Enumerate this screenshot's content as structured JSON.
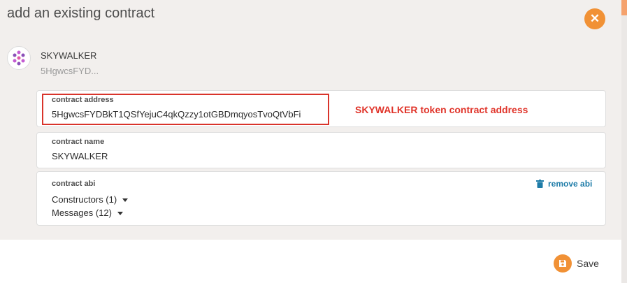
{
  "modal": {
    "title": "add an existing contract",
    "close_icon": "close-icon"
  },
  "account": {
    "name": "SKYWALKER",
    "address_short": "5HgwcsFYD..."
  },
  "fields": {
    "address": {
      "label": "contract address",
      "value": "5HgwcsFYDBkT1QSfYejuC4qkQzzy1otGBDmqyosTvoQtVbFi"
    },
    "name": {
      "label": "contract name",
      "value": "SKYWALKER"
    },
    "abi": {
      "label": "contract abi",
      "remove_label": "remove abi",
      "constructors": "Constructors (1)",
      "messages": "Messages (12)"
    }
  },
  "annotation": {
    "text": "SKYWALKER token contract address",
    "color": "#e0342a"
  },
  "footer": {
    "save_label": "Save"
  },
  "colors": {
    "accent": "#f19135",
    "link": "#1e7ca8",
    "modal_bg": "#f2efed"
  }
}
